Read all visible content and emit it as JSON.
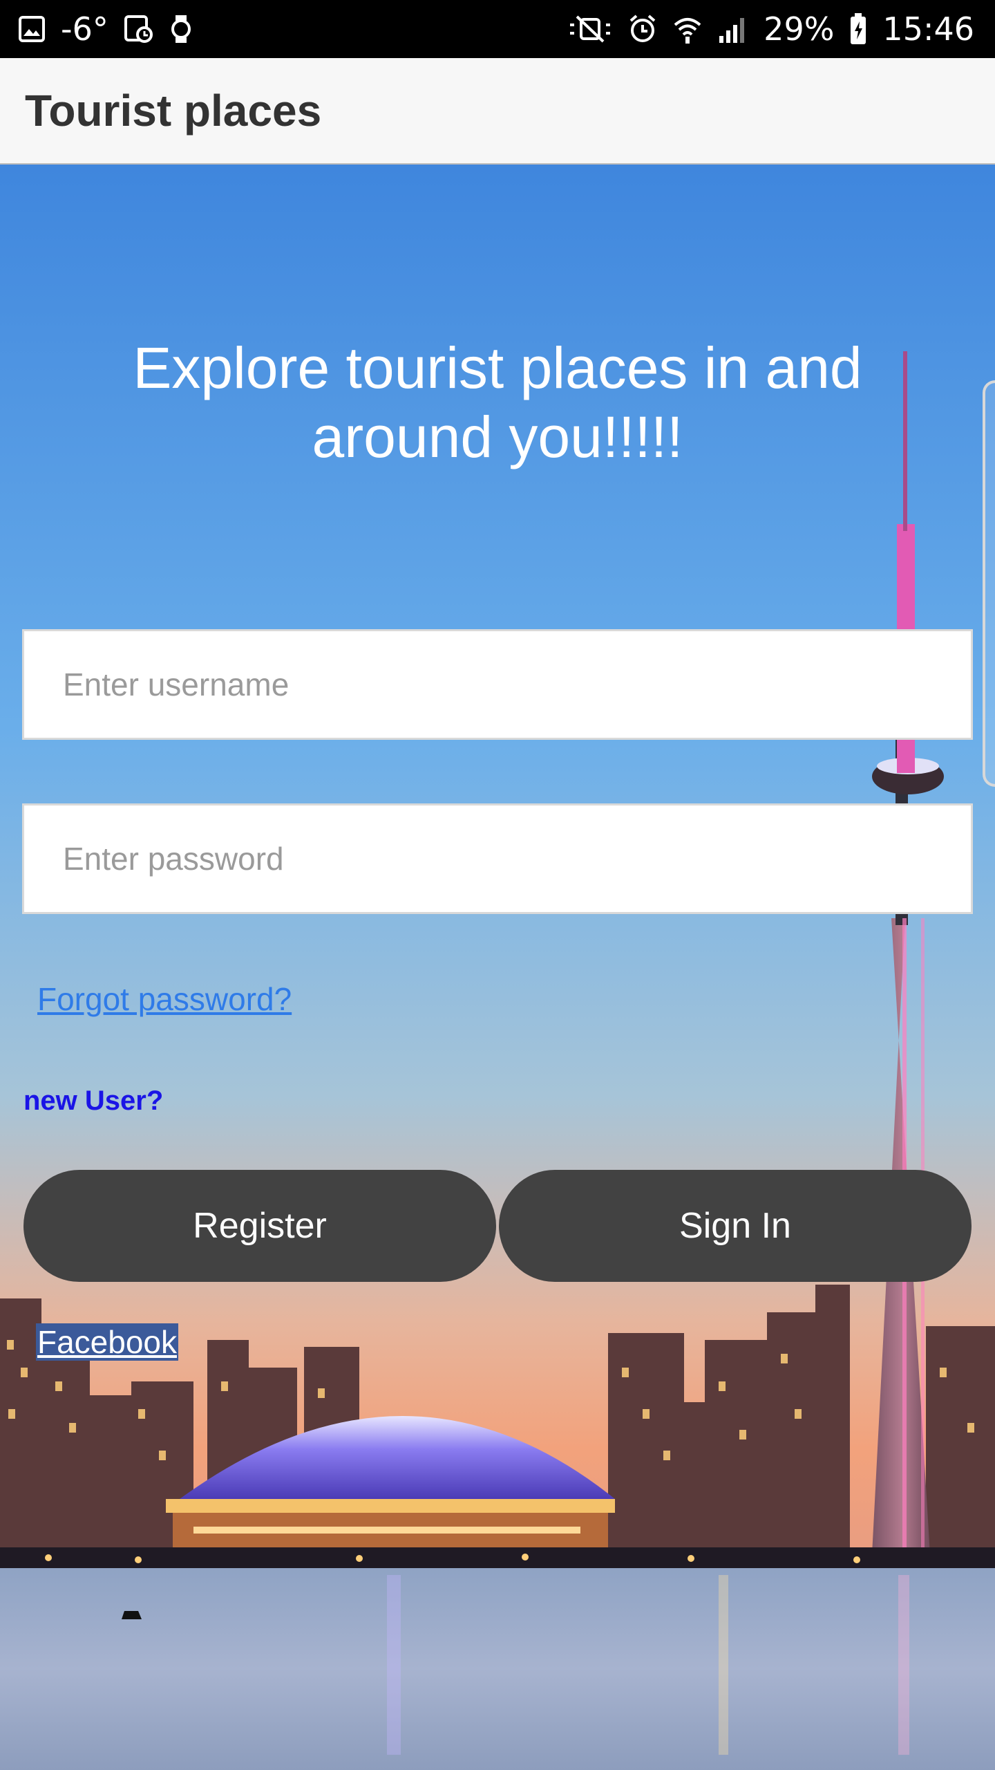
{
  "status_bar": {
    "temperature": "-6°",
    "battery_percent": "29%",
    "time": "15:46",
    "icons": [
      "image-icon",
      "calendar-icon",
      "watch-icon",
      "mute-icon",
      "alarm-icon",
      "wifi-icon",
      "signal-icon",
      "battery-icon"
    ]
  },
  "app_bar": {
    "title": "Tourist places"
  },
  "hero": {
    "headline": "Explore tourist places in and around you!!!!!"
  },
  "login": {
    "username_placeholder": "Enter username",
    "username_value": "",
    "password_placeholder": "Enter password",
    "password_value": "",
    "forgot_label": "Forgot password?",
    "new_user_label": "new User?",
    "register_label": "Register",
    "signin_label": "Sign In",
    "facebook_label": "Facebook"
  },
  "colors": {
    "button_bg": "#424242",
    "link_blue": "#2f7be8",
    "new_user_blue": "#1a14e6",
    "facebook_bg": "#3b5a9a"
  }
}
